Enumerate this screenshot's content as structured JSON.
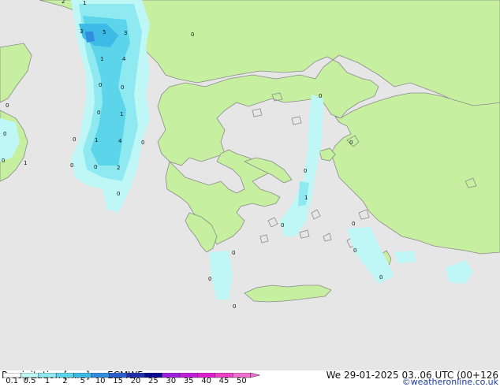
{
  "footer": {
    "title": "Precipitation [mm]",
    "model": "ECMWF",
    "datetime": "We 29-01-2025 03..06 UTC (00+126",
    "credit": "©weatheronline.co.uk"
  },
  "legend": {
    "ticks": [
      "0.1",
      "0.5",
      "1",
      "2",
      "5",
      "10",
      "15",
      "20",
      "25",
      "30",
      "35",
      "40",
      "45",
      "50"
    ],
    "colors": [
      "#ffffff",
      "#bff7f7",
      "#8eeaf0",
      "#5cd5ea",
      "#3ebae6",
      "#2f8ee0",
      "#2a5fd0",
      "#1f2fb0",
      "#0a0a90",
      "#a020e0",
      "#c020d8",
      "#e020d0",
      "#f040c8",
      "#f070d0"
    ]
  },
  "map": {
    "sea_color": "#e6e6e6",
    "land_color": "#c6f0a0",
    "point_labels": [
      "2",
      "1",
      "3",
      "5",
      "3",
      "1",
      "4",
      "0",
      "0",
      "0",
      "1",
      "4",
      "0",
      "0",
      "0",
      "0",
      "1",
      "2",
      "0",
      "1",
      "0",
      "0",
      "0",
      "0",
      "1",
      "0",
      "0",
      "0",
      "0",
      "0",
      "0",
      "0",
      "0",
      "0",
      "0"
    ]
  }
}
